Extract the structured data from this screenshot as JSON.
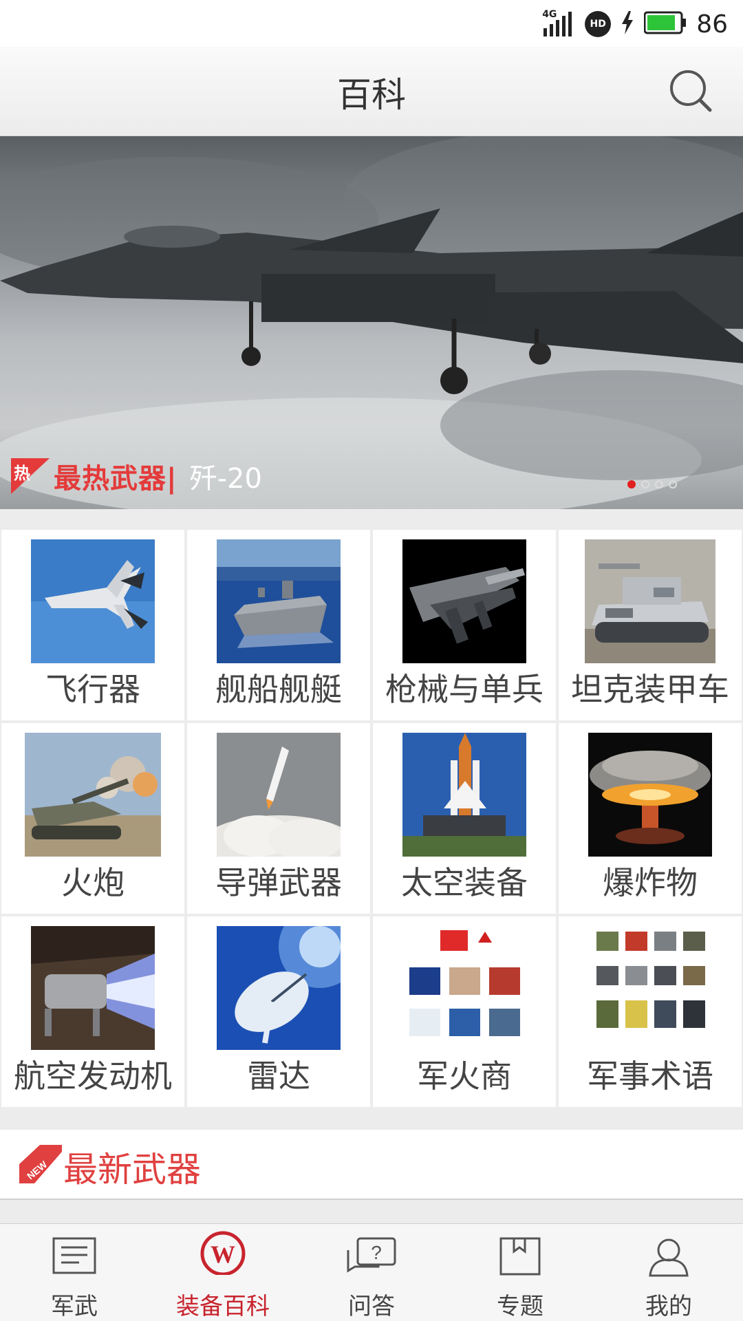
{
  "status_bar": {
    "network": "4G",
    "hd_badge": "HD",
    "battery": "86",
    "battery_level": 0.86,
    "icons": [
      "signal-icon",
      "hd-icon",
      "charging-icon",
      "battery-icon"
    ]
  },
  "header": {
    "title": "百科",
    "search_icon": "search-icon"
  },
  "banner": {
    "tag_flag": "热",
    "tag": "最热武器|",
    "title": "歼-20",
    "slide_count": 4,
    "active_slide": 0
  },
  "categories": [
    {
      "label": "飞行器"
    },
    {
      "label": "舰船舰艇"
    },
    {
      "label": "枪械与单兵"
    },
    {
      "label": "坦克装甲车"
    },
    {
      "label": "火炮"
    },
    {
      "label": "导弹武器"
    },
    {
      "label": "太空装备"
    },
    {
      "label": "爆炸物"
    },
    {
      "label": "航空发动机"
    },
    {
      "label": "雷达"
    },
    {
      "label": "军火商"
    },
    {
      "label": "军事术语"
    }
  ],
  "newest": {
    "badge": "NEW",
    "title": "最新武器"
  },
  "bottom_nav": [
    {
      "label": "军武",
      "icon": "news-icon",
      "active": false
    },
    {
      "label": "装备百科",
      "icon": "wiki-icon",
      "active": true
    },
    {
      "label": "问答",
      "icon": "qa-icon",
      "active": false
    },
    {
      "label": "专题",
      "icon": "topic-icon",
      "active": false
    },
    {
      "label": "我的",
      "icon": "profile-icon",
      "active": false
    }
  ],
  "colors": {
    "accent": "#c8242e",
    "tag_red": "#e43a3a",
    "background": "#ececec"
  }
}
